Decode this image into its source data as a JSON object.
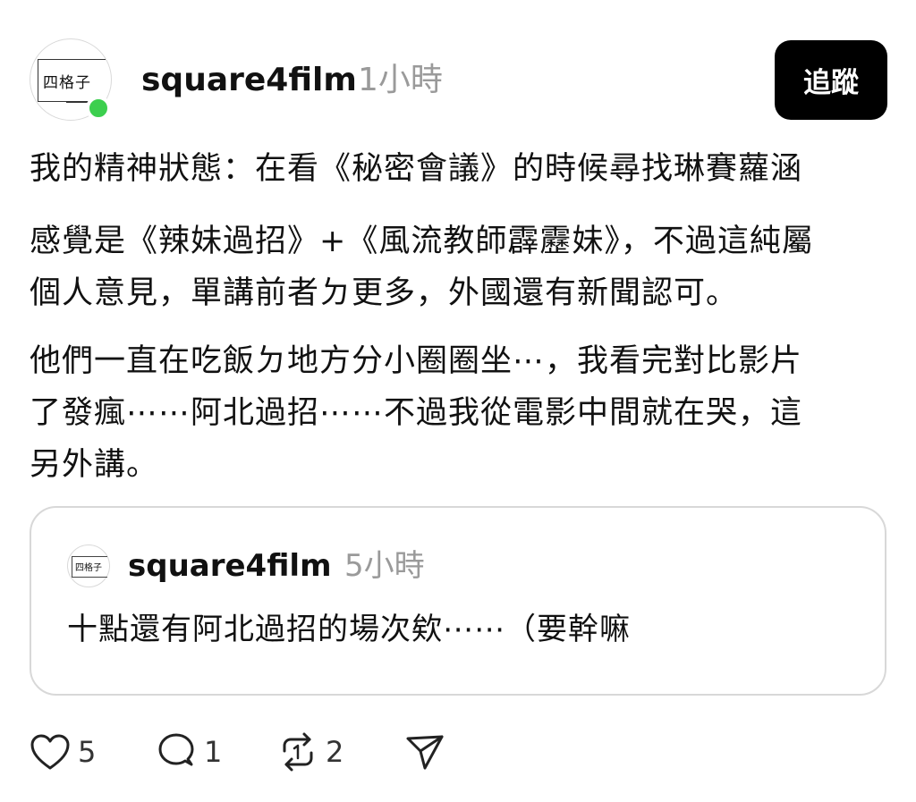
{
  "post": {
    "avatar_logo_text": "四格子",
    "username": "square4film",
    "timestamp": "1小時",
    "follow_label": "追蹤",
    "paragraphs": [
      "我的精神狀態：在看《秘密會議》的時候尋找琳賽蘿涵",
      "感覺是《辣妹過招》+《風流教師霹靂妹》，不過這純屬\n個人意見，單講前者ㄉ更多，外國還有新聞認可。",
      "他們一直在吃飯ㄉ地方分小圈圈坐⋯，我看完對比影片\n了發瘋⋯⋯阿北過招⋯⋯不過我從電影中間就在哭，這\n另外講。"
    ]
  },
  "quoted_post": {
    "avatar_logo_text": "四格子",
    "username": "square4film",
    "timestamp": "5小時",
    "text": "十點還有阿北過招的場次欸⋯⋯（要幹嘛"
  },
  "actions": {
    "like_count": "5",
    "reply_count": "1",
    "repost_count": "2"
  },
  "colors": {
    "online_dot": "#3ccf4e",
    "follow_button_bg": "#000000",
    "muted_text": "#9a9a9a"
  },
  "icons": [
    "heart-icon",
    "comment-icon",
    "repost-icon",
    "share-icon"
  ]
}
